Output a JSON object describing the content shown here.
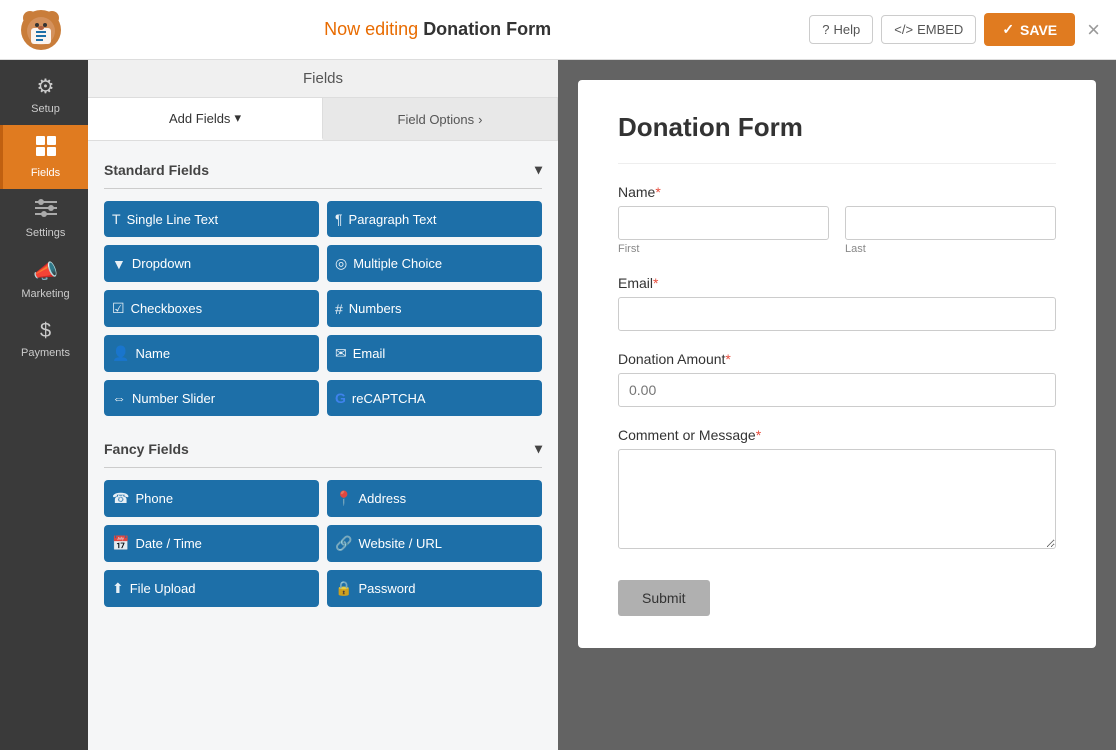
{
  "header": {
    "now_editing_label": "Now editing",
    "form_name": "Donation Form",
    "help_label": "Help",
    "embed_label": "EMBED",
    "save_label": "SAVE",
    "close_label": "×"
  },
  "sidebar": {
    "items": [
      {
        "id": "setup",
        "label": "Setup",
        "icon": "⚙"
      },
      {
        "id": "fields",
        "label": "Fields",
        "icon": "▦",
        "active": true
      },
      {
        "id": "settings",
        "label": "Settings",
        "icon": "≡"
      },
      {
        "id": "marketing",
        "label": "Marketing",
        "icon": "📣"
      },
      {
        "id": "payments",
        "label": "Payments",
        "icon": "$"
      }
    ]
  },
  "fields_panel": {
    "header": "Fields",
    "tabs": [
      {
        "id": "add-fields",
        "label": "Add Fields",
        "active": true
      },
      {
        "id": "field-options",
        "label": "Field Options"
      }
    ],
    "standard_fields": {
      "label": "Standard Fields",
      "buttons": [
        {
          "id": "single-line-text",
          "label": "Single Line Text",
          "icon": "T"
        },
        {
          "id": "paragraph-text",
          "label": "Paragraph Text",
          "icon": "¶"
        },
        {
          "id": "dropdown",
          "label": "Dropdown",
          "icon": "▼"
        },
        {
          "id": "multiple-choice",
          "label": "Multiple Choice",
          "icon": "◎"
        },
        {
          "id": "checkboxes",
          "label": "Checkboxes",
          "icon": "☑"
        },
        {
          "id": "numbers",
          "label": "Numbers",
          "icon": "#"
        },
        {
          "id": "name",
          "label": "Name",
          "icon": "👤"
        },
        {
          "id": "email",
          "label": "Email",
          "icon": "✉"
        },
        {
          "id": "number-slider",
          "label": "Number Slider",
          "icon": "⇔"
        },
        {
          "id": "recaptcha",
          "label": "reCAPTCHA",
          "icon": "G"
        }
      ]
    },
    "fancy_fields": {
      "label": "Fancy Fields",
      "buttons": [
        {
          "id": "phone",
          "label": "Phone",
          "icon": "☎"
        },
        {
          "id": "address",
          "label": "Address",
          "icon": "📍"
        },
        {
          "id": "date-time",
          "label": "Date / Time",
          "icon": "📅"
        },
        {
          "id": "website-url",
          "label": "Website / URL",
          "icon": "🔗"
        },
        {
          "id": "file-upload",
          "label": "File Upload",
          "icon": "⬆"
        },
        {
          "id": "password",
          "label": "Password",
          "icon": "🔒"
        }
      ]
    }
  },
  "form_preview": {
    "title": "Donation Form",
    "fields": [
      {
        "id": "name",
        "label": "Name",
        "required": true,
        "type": "name",
        "sub_labels": [
          "First",
          "Last"
        ]
      },
      {
        "id": "email",
        "label": "Email",
        "required": true,
        "type": "email"
      },
      {
        "id": "donation-amount",
        "label": "Donation Amount",
        "required": true,
        "type": "number",
        "placeholder": "0.00"
      },
      {
        "id": "comment-message",
        "label": "Comment or Message",
        "required": true,
        "type": "textarea"
      }
    ],
    "submit_label": "Submit"
  }
}
